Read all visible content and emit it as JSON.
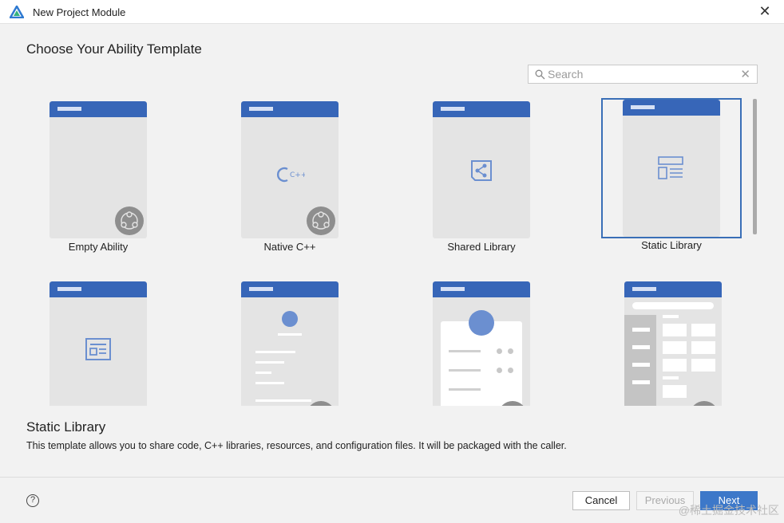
{
  "window": {
    "title": "New Project Module",
    "close_icon": "close-icon"
  },
  "heading": "Choose Your Ability Template",
  "search": {
    "placeholder": "Search",
    "value": ""
  },
  "templates": [
    {
      "label": "Empty Ability",
      "selected": false
    },
    {
      "label": "Native C++",
      "selected": false
    },
    {
      "label": "Shared Library",
      "selected": false
    },
    {
      "label": "Static Library",
      "selected": true
    },
    {
      "label": "",
      "selected": false
    },
    {
      "label": "",
      "selected": false
    },
    {
      "label": "",
      "selected": false
    },
    {
      "label": "",
      "selected": false
    }
  ],
  "icons": {
    "native": "C++"
  },
  "description": {
    "title": "Static Library",
    "text": "This template allows you to share code, C++ libraries, resources, and configuration files. It will be packaged with the caller."
  },
  "footer": {
    "help": "?",
    "cancel": "Cancel",
    "previous": "Previous",
    "next": "Next"
  },
  "watermark": "@稀土掘金技术社区",
  "colors": {
    "accent": "#3766b8",
    "selected_border": "#3a6fb7",
    "next_button": "#3d78c9"
  }
}
